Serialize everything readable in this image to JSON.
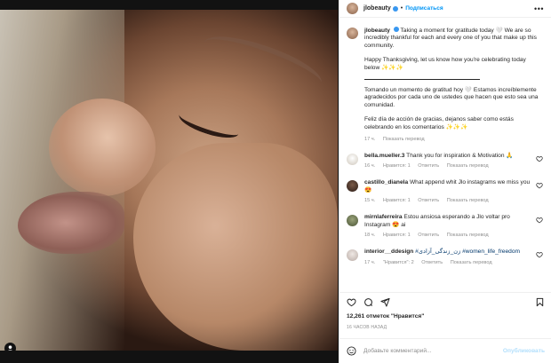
{
  "post": {
    "username": "jlobeauty",
    "follow_label": "Подписаться",
    "separator": "•",
    "more": "•••"
  },
  "caption": {
    "username": "jlobeauty",
    "p1": "Taking a moment for gratitude today 🤍 We are so incredibly thankful for each and every one of you that make up this community.",
    "p2": "Happy Thanksgiving, let us know how you're celebrating today below ✨✨✨",
    "p3": "Tomando un momento de gratitud hoy 🤍 Estamos increíblemente agradecidos por cada uno de ustedes que hacen que esto sea una comunidad.",
    "p4": "Feliz día de acción de gracias, dejanos saber como estás celebrando en los comentarios ✨✨✨",
    "time": "17 ч.",
    "translate": "Показать перевод"
  },
  "comments": [
    {
      "user": "bella.mueller.3",
      "text": "Thank you for inspiration & Motivation 🙏",
      "time": "16 ч.",
      "likes": "Нравится: 1",
      "reply": "Ответить",
      "translate": "Показать перевод",
      "avatar_color": "#e8e2d8"
    },
    {
      "user": "castillo_dianela",
      "text": "What append whit Jlo instagrams we miss you 😍",
      "time": "15 ч.",
      "likes": "Нравится: 1",
      "reply": "Ответить",
      "translate": "Показать перевод",
      "avatar_color": "#3a2a22"
    },
    {
      "user": "mirnlaferreira",
      "text": "Estou ansiosa esperando a Jlo voltar pro Instagram 😍 ai",
      "time": "18 ч.",
      "likes": "Нравится: 1",
      "reply": "Ответить",
      "translate": "Показать перевод",
      "avatar_color": "#6a7a52"
    },
    {
      "user": "interior__ddesign",
      "text": "#زن_زندگی_آزادی #women_life_freedom",
      "time": "17 ч.",
      "likes": "\"Нравится\": 2",
      "reply": "Ответить",
      "translate": "Показать перевод",
      "avatar_color": "#d8d0cc"
    }
  ],
  "likes": {
    "count": "12,261",
    "label": "отметок \"Нравится\""
  },
  "timestamp": "16 ЧАСОВ НАЗАД",
  "comment_input": {
    "placeholder": "Добавьте комментарий...",
    "publish": "Опубликовать"
  },
  "colors": {
    "accent": "#0095f6",
    "verified": "#3897f0",
    "muted": "#8e8e8e",
    "publish_disabled": "#b2dffc"
  },
  "icons": [
    "heart-icon",
    "comment-icon",
    "share-icon",
    "bookmark-icon",
    "emoji-icon",
    "more-icon",
    "user-tag-icon"
  ]
}
